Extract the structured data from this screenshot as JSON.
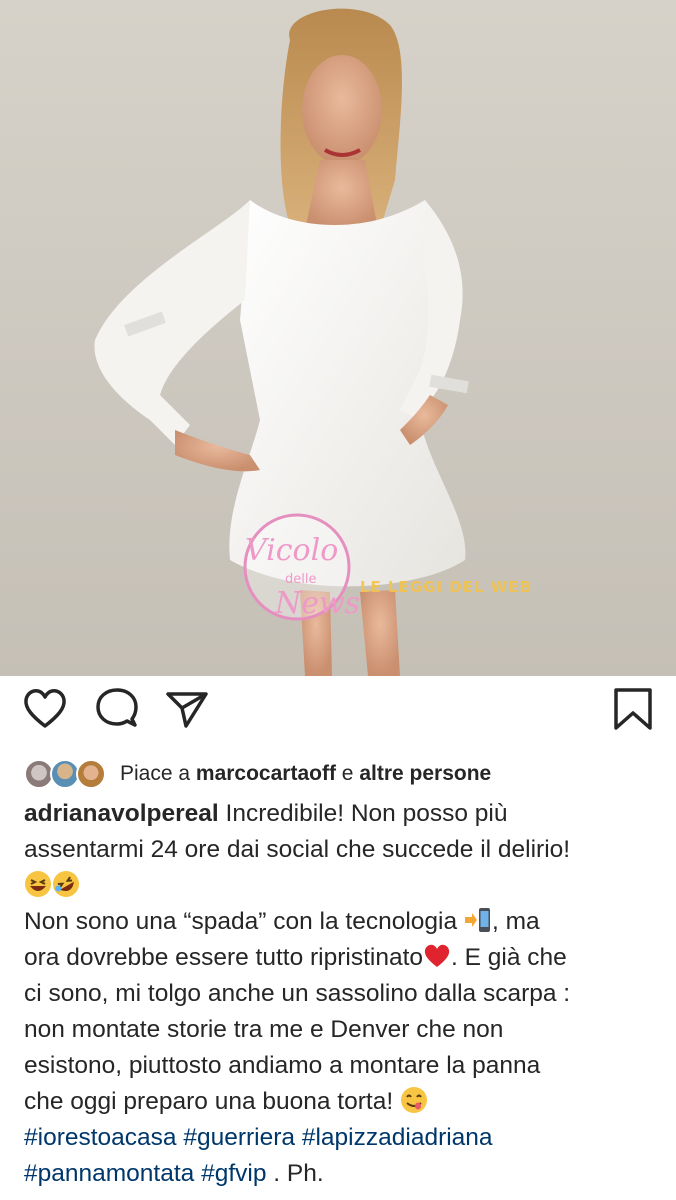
{
  "post": {
    "image_alt": "Woman in white dress",
    "watermark_lines": [
      "Vicolo",
      "delle",
      "News"
    ],
    "watermark_tagline": "LE LEGGI DEL WEB"
  },
  "actions": {
    "like_icon": "heart-icon",
    "comment_icon": "comment-icon",
    "share_icon": "send-icon",
    "save_icon": "bookmark-icon"
  },
  "likes": {
    "prefix": "Piace a",
    "user": "marcocartaoff",
    "joiner": "e",
    "rest": "altre persone"
  },
  "caption": {
    "username": "adrianavolpereal",
    "line1": "Incredibile! Non posso più",
    "line2": "assentarmi 24 ore dai social che succede il delirio!",
    "line4a": "Non sono una “spada” con la tecnologia",
    "line4b": ", ma",
    "line5a": "ora dovrebbe essere tutto ripristinato",
    "line5b": ". E già  che",
    "line6": "ci sono, mi tolgo anche un sassolino dalla scarpa :",
    "line7": "non montate storie tra me e Denver che non",
    "line8": "esistono, piuttosto andiamo a montare la panna",
    "line9": "che oggi preparo una buona torta!",
    "hashtags1": [
      "#iorestoacasa",
      "#guerriera",
      "#lapizzadiadriana"
    ],
    "hashtags2": [
      "#pannamontata",
      "#gfvip"
    ],
    "tail": ". Ph."
  },
  "colors": {
    "hashtag": "#00376b",
    "text": "#262626",
    "heart": "#e0242f"
  }
}
